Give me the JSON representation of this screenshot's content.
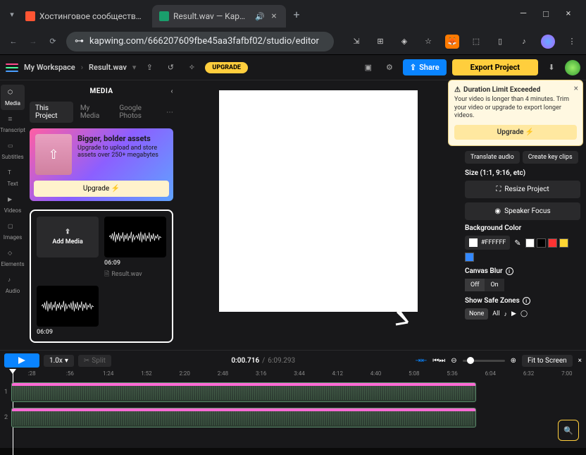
{
  "browser": {
    "tabs": [
      {
        "title": "Хостинговое сообщество «Tim",
        "favicon": "#ff5533"
      },
      {
        "title": "Result.wav — Kapwing",
        "favicon": "#1a9e6c"
      }
    ],
    "url": "kapwing.com/666207609fbe45aa3fafbf02/studio/editor"
  },
  "app": {
    "workspace": "My Workspace",
    "file": "Result.wav",
    "upgrade": "UPGRADE",
    "share": "Share",
    "export": "Export Project"
  },
  "rail": [
    {
      "label": "Media",
      "icon": "⬡"
    },
    {
      "label": "Transcript",
      "icon": "≣"
    },
    {
      "label": "Subtitles",
      "icon": "▭"
    },
    {
      "label": "Text",
      "icon": "T"
    },
    {
      "label": "Videos",
      "icon": "▶"
    },
    {
      "label": "Images",
      "icon": "▢"
    },
    {
      "label": "Elements",
      "icon": "◇"
    },
    {
      "label": "Audio",
      "icon": "♪"
    }
  ],
  "media": {
    "title": "MEDIA",
    "tabs": [
      "This Project",
      "My Media",
      "Google Photos"
    ],
    "promo": {
      "title": "Bigger, bolder assets",
      "body": "Upgrade to upload and store assets over 250+ megabytes",
      "cta": "Upgrade ⚡"
    },
    "add": "Add Media",
    "clip": {
      "dur": "06:09",
      "name": "Result.wav"
    }
  },
  "toast": {
    "title": "Duration Limit Exceeded",
    "body": "Your video is longer than 4 minutes. Trim your video or upgrade to export longer videos.",
    "cta": "Upgrade ⚡"
  },
  "right": {
    "pills": [
      "Translate audio",
      "Create key clips"
    ],
    "size_label": "Size (1:1, 9:16, etc)",
    "resize": "Resize Project",
    "speaker": "Speaker Focus",
    "bg_label": "Background Color",
    "hex": "#FFFFFF",
    "swatches": [
      "#ffffff",
      "#000000",
      "#ff3333",
      "#ffd633",
      "#3388ff"
    ],
    "blur_label": "Canvas Blur",
    "blur": [
      "Off",
      "On"
    ],
    "safe_label": "Show Safe Zones",
    "safe": [
      "None",
      "All"
    ]
  },
  "timeline": {
    "speed": "1.0x",
    "split": "Split",
    "current": "0:00.716",
    "duration": "6:09.293",
    "fit": "Fit to Screen",
    "ruler": [
      ":28",
      ":56",
      "1:24",
      "1:52",
      "2:20",
      "2:48",
      "3:16",
      "3:44",
      "4:12",
      "4:40",
      "5:08",
      "5:36",
      "6:04",
      "6:32",
      "7:00"
    ]
  }
}
